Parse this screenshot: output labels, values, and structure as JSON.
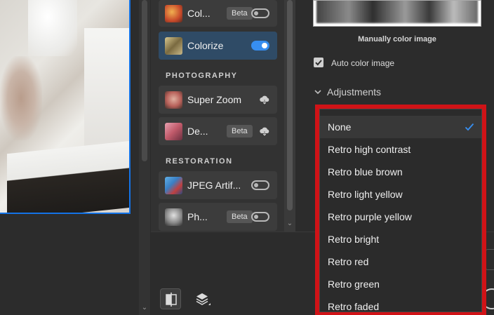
{
  "filters_panel": {
    "items_top": [
      {
        "label": "Col...",
        "badge": "Beta",
        "toggle": "off",
        "thumb_color": "#c84a2a"
      },
      {
        "label": "Colorize",
        "toggle": "on",
        "thumb_color": "#a8956a"
      }
    ],
    "section_photography": "PHOTOGRAPHY",
    "photography_items": [
      {
        "label": "Super Zoom",
        "action": "cloud-download-icon",
        "thumb_color": "#b8615a"
      },
      {
        "label": "De...",
        "badge": "Beta",
        "action": "cloud-download-icon",
        "thumb_color": "#c05a6a"
      }
    ],
    "section_restoration": "RESTORATION",
    "restoration_items": [
      {
        "label": "JPEG Artif...",
        "toggle": "off",
        "thumb_color": "#3a7fc4"
      },
      {
        "label": "Ph...",
        "badge": "Beta",
        "toggle": "off",
        "thumb_color": "#8a8a8a"
      }
    ]
  },
  "right_panel": {
    "preview_caption": "Manually color image",
    "auto_color_label": "Auto color image",
    "auto_color_checked": true,
    "adjustments_label": "Adjustments"
  },
  "adjustments_menu": {
    "selected": "None",
    "options": [
      "None",
      "Retro high contrast",
      "Retro blue brown",
      "Retro light yellow",
      "Retro purple yellow",
      "Retro bright",
      "Retro red",
      "Retro green",
      "Retro faded"
    ]
  },
  "colors": {
    "accent": "#378ef0",
    "highlight_border": "#d01317",
    "active_item": "#2f4b66"
  }
}
